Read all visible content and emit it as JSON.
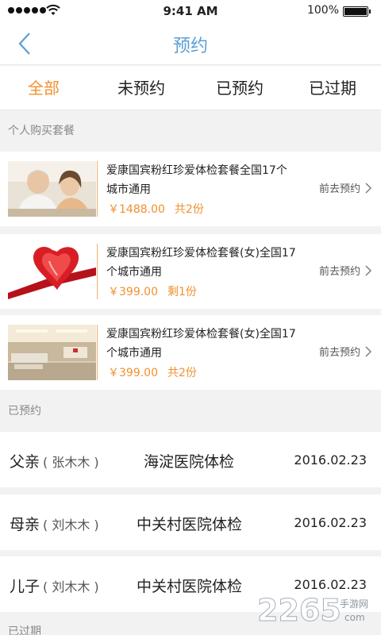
{
  "status": {
    "time": "9:41 AM",
    "battery": "100%"
  },
  "nav": {
    "title": "预约"
  },
  "tabs": [
    {
      "label": "全部"
    },
    {
      "label": "未预约"
    },
    {
      "label": "已预约"
    },
    {
      "label": "已过期"
    }
  ],
  "sections": {
    "personal": "个人购买套餐",
    "booked": "已预约",
    "expired": "已过期"
  },
  "packages": [
    {
      "name": "爱康国宾粉红珍爱体检套餐全国17个城市通用",
      "price": "￥1488.00",
      "quantity": "共2份",
      "action": "前去预约"
    },
    {
      "name": "爱康国宾粉红珍爱体检套餐(女)全国17个城市通用",
      "price": "￥399.00",
      "quantity": "剩1份",
      "action": "前去预约"
    },
    {
      "name": "爱康国宾粉红珍爱体检套餐(女)全国17个城市通用",
      "price": "￥399.00",
      "quantity": "共2份",
      "action": "前去预约"
    }
  ],
  "booked": [
    {
      "relation": "父亲",
      "person": "( 张木木 )",
      "hospital": "海淀医院体检",
      "date": "2016.02.23"
    },
    {
      "relation": "母亲",
      "person": "( 刘木木 )",
      "hospital": "中关村医院体检",
      "date": "2016.02.23"
    },
    {
      "relation": "儿子",
      "person": "( 刘木木 )",
      "hospital": "中关村医院体检",
      "date": "2016.02.23"
    }
  ],
  "watermark": {
    "text": "2265",
    "sub_top": "手游网",
    "sub_bottom": "com"
  },
  "colors": {
    "accent": "#f0902f",
    "title_blue": "#5a9fd6"
  }
}
